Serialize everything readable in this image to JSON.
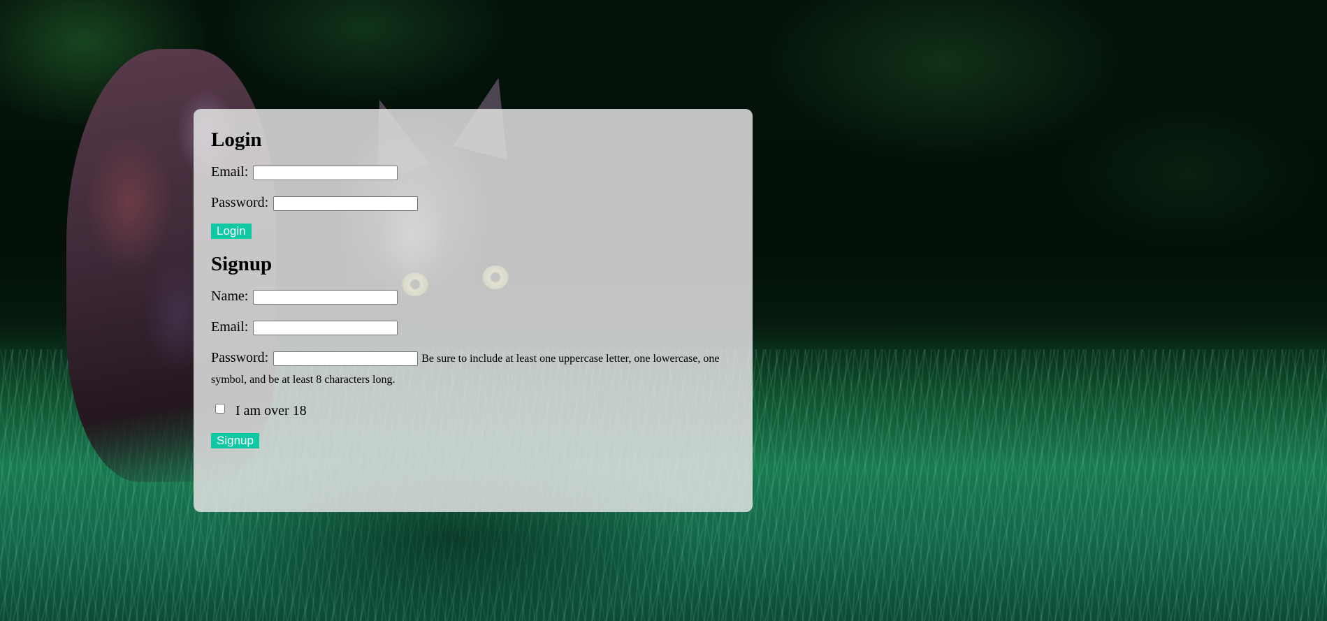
{
  "login": {
    "heading": "Login",
    "email_label": "Email:",
    "email_value": "",
    "password_label": "Password:",
    "password_value": "",
    "button_label": "Login"
  },
  "signup": {
    "heading": "Signup",
    "name_label": "Name:",
    "name_value": "",
    "email_label": "Email:",
    "email_value": "",
    "password_label": "Password:",
    "password_value": "",
    "password_hint": "Be sure to include at least one uppercase letter, one lowercase, one symbol, and be at least 8 characters long.",
    "age_checkbox_label": "I am over 18",
    "age_checkbox_checked": false,
    "button_label": "Signup"
  },
  "colors": {
    "button": "#10c9a4",
    "panel": "rgba(225,225,225,0.86)"
  }
}
